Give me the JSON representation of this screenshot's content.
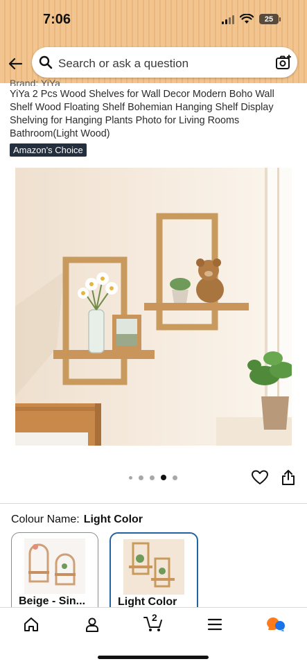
{
  "status": {
    "time": "7:06",
    "battery": "25"
  },
  "search": {
    "placeholder": "Search or ask a question"
  },
  "product": {
    "brand_partial": "Brand: YiYa",
    "title": "YiYa 2 Pcs Wood Shelves for Wall Decor Modern Boho Wall Shelf Wood Floating Shelf Bohemian Hanging Shelf Display Shelving for Hanging Plants Photo for Living Rooms Bathroom(Light Wood)",
    "badge": "Amazon's Choice"
  },
  "gallery": {
    "image_count": 5,
    "active_index": 3
  },
  "variation": {
    "label": "Colour Name:",
    "selected_value": "Light Color",
    "options": [
      {
        "label": "Beige - Sin..."
      },
      {
        "label": "Light Color"
      }
    ]
  },
  "cart": {
    "count": "2"
  },
  "colors": {
    "header": "#f2c48f",
    "selected_border": "#2162a1",
    "badge_bg": "#232f3e"
  }
}
